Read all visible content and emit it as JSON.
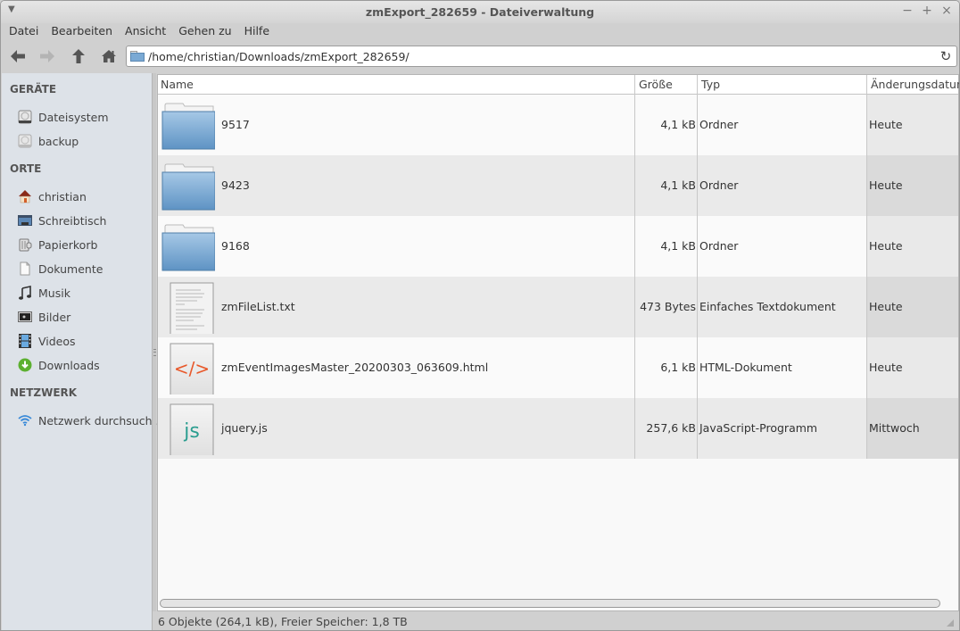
{
  "window": {
    "title": "zmExport_282659 - Dateiverwaltung",
    "controls": {
      "minimize": "−",
      "maximize": "+",
      "close": "×"
    }
  },
  "menubar": [
    "Datei",
    "Bearbeiten",
    "Ansicht",
    "Gehen zu",
    "Hilfe"
  ],
  "toolbar": {
    "back_icon": "arrow-left",
    "forward_icon": "arrow-right",
    "up_icon": "arrow-up",
    "home_icon": "home",
    "path": "/home/christian/Downloads/zmExport_282659/",
    "reload_icon": "reload"
  },
  "sidebar": {
    "sections": [
      {
        "heading": "GERÄTE",
        "items": [
          {
            "label": "Dateisystem",
            "icon": "drive"
          },
          {
            "label": "backup",
            "icon": "drive"
          }
        ]
      },
      {
        "heading": "ORTE",
        "items": [
          {
            "label": "christian",
            "icon": "home"
          },
          {
            "label": "Schreibtisch",
            "icon": "desktop"
          },
          {
            "label": "Papierkorb",
            "icon": "trash"
          },
          {
            "label": "Dokumente",
            "icon": "document"
          },
          {
            "label": "Musik",
            "icon": "music"
          },
          {
            "label": "Bilder",
            "icon": "pictures"
          },
          {
            "label": "Videos",
            "icon": "videos"
          },
          {
            "label": "Downloads",
            "icon": "downloads"
          }
        ]
      },
      {
        "heading": "NETZWERK",
        "items": [
          {
            "label": "Netzwerk durchsuch...",
            "icon": "wifi"
          }
        ]
      }
    ]
  },
  "columns": {
    "name": "Name",
    "size": "Größe",
    "type": "Typ",
    "date": "Änderungsdatum"
  },
  "files": [
    {
      "name": "9517",
      "size": "4,1 kB",
      "type": "Ordner",
      "date": "Heute",
      "icon": "folder"
    },
    {
      "name": "9423",
      "size": "4,1 kB",
      "type": "Ordner",
      "date": "Heute",
      "icon": "folder"
    },
    {
      "name": "9168",
      "size": "4,1 kB",
      "type": "Ordner",
      "date": "Heute",
      "icon": "folder"
    },
    {
      "name": "zmFileList.txt",
      "size": "473 Bytes",
      "type": "Einfaches Textdokument",
      "date": "Heute",
      "icon": "text-file"
    },
    {
      "name": "zmEventImagesMaster_20200303_063609.html",
      "size": "6,1 kB",
      "type": "HTML-Dokument",
      "date": "Heute",
      "icon": "html-file"
    },
    {
      "name": "jquery.js",
      "size": "257,6 kB",
      "type": "JavaScript-Programm",
      "date": "Mittwoch",
      "icon": "js-file"
    }
  ],
  "status": "6 Objekte (264,1 kB), Freier Speicher: 1,8 TB",
  "colors": {
    "folder": "#6a9fcc",
    "html_accent": "#e8582a",
    "js_accent": "#2a9d8f",
    "sidebar_bg": "#dde2e8"
  }
}
